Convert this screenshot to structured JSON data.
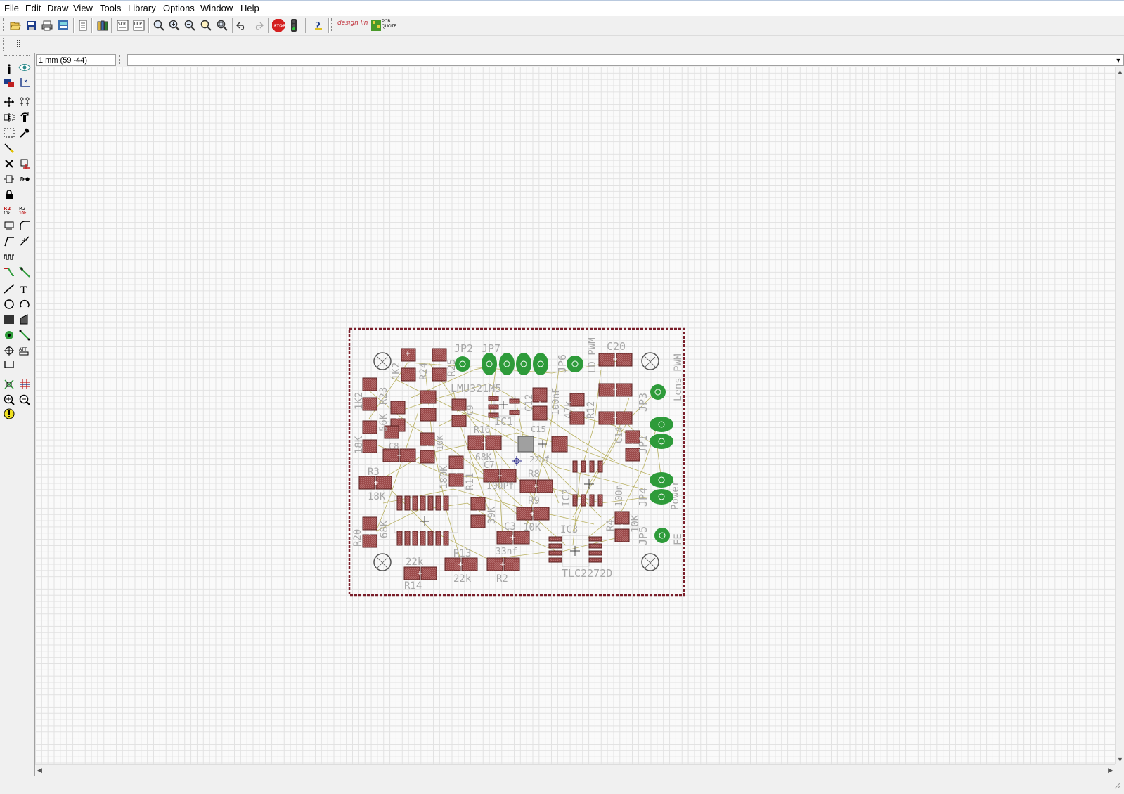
{
  "menu": [
    "File",
    "Edit",
    "Draw",
    "View",
    "Tools",
    "Library",
    "Options",
    "Window",
    "Help"
  ],
  "toolbar": {
    "buttons": [
      "open-icon",
      "save-icon",
      "print-icon",
      "cam-processor-icon",
      "switch-to-schematic-icon",
      "library-icon",
      "script-icon",
      "ulp-icon",
      "zoom-to-fit-icon",
      "zoom-in-icon",
      "zoom-out-icon",
      "zoom-redraw-icon",
      "zoom-select-icon",
      "undo-icon",
      "redo-icon",
      "stop-icon",
      "go-icon",
      "help-icon"
    ],
    "designlink_label": "design link",
    "pcbquote_label": "PCB QUOTE"
  },
  "coordinates": "1 mm (59 -44)",
  "command_line": "",
  "board": {
    "labels": {
      "jp2": "JP2",
      "jp7": "JP7",
      "jp6": "JP6",
      "jp3": "JP3",
      "jp1": "JP1",
      "jp4": "JP4",
      "jp5": "JP5",
      "c20": "C20",
      "c14": "C14",
      "c15": "C15",
      "c12": "C12",
      "c9": "C9",
      "c8": "C8",
      "c7": "C7",
      "c3": "C3",
      "r2": "R2",
      "r3": "R3",
      "r4": "R4",
      "r8": "R8",
      "r9": "R9",
      "r11": "R11",
      "r12": "R12",
      "r13": "R13",
      "r14": "R14",
      "r16": "R16",
      "r20": "R20",
      "r23": "R23",
      "r24": "R24",
      "r25": "R25",
      "ic1": "IC1",
      "ic2": "IC2",
      "ic3": "IC3",
      "lmu": "LMU321M5",
      "tlc": "TLC2272D",
      "v_1k2": "1K2",
      "v_1k2b": "1K2",
      "v_18k": "18K",
      "v_18kb": "18K",
      "v_56k": "56K",
      "v_68k": "68K",
      "v_68kb": "68K",
      "v_100nf": "100nF",
      "v_47k": "47k",
      "v_100pf": "100Pf",
      "v_22uf": "22uf",
      "v_10k": "10K",
      "v_10kb": "10K",
      "v_10kc": "10K",
      "v_22k": "22k",
      "v_22kb": "22k",
      "v_33nf": "33nf",
      "v_180k": "180K",
      "v_39k": "39K",
      "v_100n": "100n",
      "v_100nb": "100n",
      "lens_pwm": "Lens PWM",
      "ld_pwm": "LD PWM",
      "fe": "FE",
      "power": "Power"
    }
  },
  "colors": {
    "pad": "#9b4a4a",
    "pad_hatch": "#c08080",
    "via": "#2e9b3a",
    "airwire": "#b8b060",
    "outline": "#7a1e2a",
    "label": "#a8a8a8"
  }
}
